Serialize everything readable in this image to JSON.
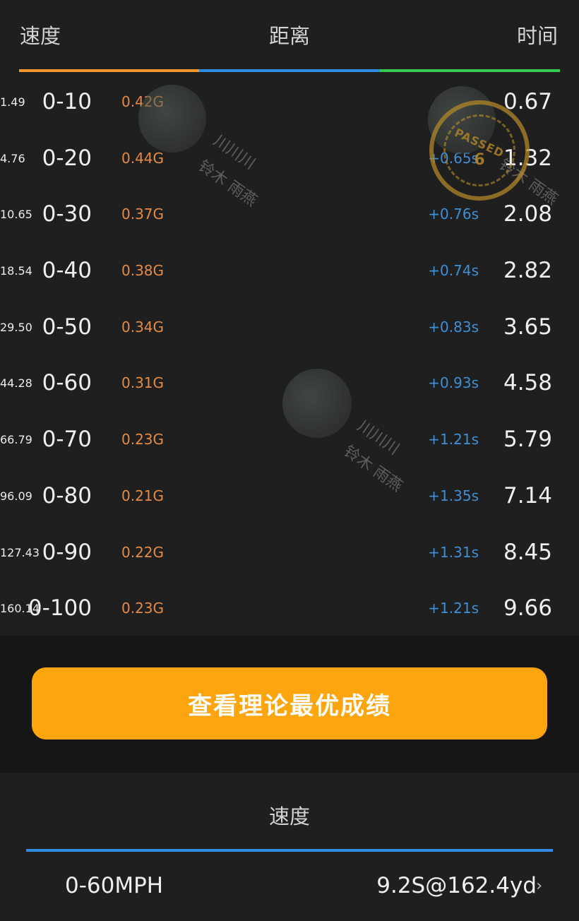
{
  "header": {
    "speed": "速度",
    "distance": "距离",
    "time": "时间"
  },
  "tab_colors": [
    "#f3952b",
    "#2f8be3",
    "#35c94d"
  ],
  "rows": [
    {
      "range": "0-10",
      "g": "0.42G",
      "distance": "1.49",
      "delta": "",
      "time": "0.67"
    },
    {
      "range": "0-20",
      "g": "0.44G",
      "distance": "4.76",
      "delta": "+0.65s",
      "time": "1.32"
    },
    {
      "range": "0-30",
      "g": "0.37G",
      "distance": "10.65",
      "delta": "+0.76s",
      "time": "2.08"
    },
    {
      "range": "0-40",
      "g": "0.38G",
      "distance": "18.54",
      "delta": "+0.74s",
      "time": "2.82"
    },
    {
      "range": "0-50",
      "g": "0.34G",
      "distance": "29.50",
      "delta": "+0.83s",
      "time": "3.65"
    },
    {
      "range": "0-60",
      "g": "0.31G",
      "distance": "44.28",
      "delta": "+0.93s",
      "time": "4.58"
    },
    {
      "range": "0-70",
      "g": "0.23G",
      "distance": "66.79",
      "delta": "+1.21s",
      "time": "5.79"
    },
    {
      "range": "0-80",
      "g": "0.21G",
      "distance": "96.09",
      "delta": "+1.35s",
      "time": "7.14"
    },
    {
      "range": "0-90",
      "g": "0.22G",
      "distance": "127.43",
      "delta": "+1.31s",
      "time": "8.45"
    },
    {
      "range": "0-100",
      "g": "0.23G",
      "distance": "160.14",
      "delta": "+1.21s",
      "time": "9.66"
    }
  ],
  "button": {
    "label": "查看理论最优成绩"
  },
  "bottom": {
    "header": "速度",
    "label": "0-60MPH",
    "value": "9.2S@162.4yd"
  },
  "watermark": {
    "line1": "川川川",
    "line2": "铃木 雨燕"
  },
  "stamp": {
    "text": "PASSED",
    "number": "6"
  }
}
